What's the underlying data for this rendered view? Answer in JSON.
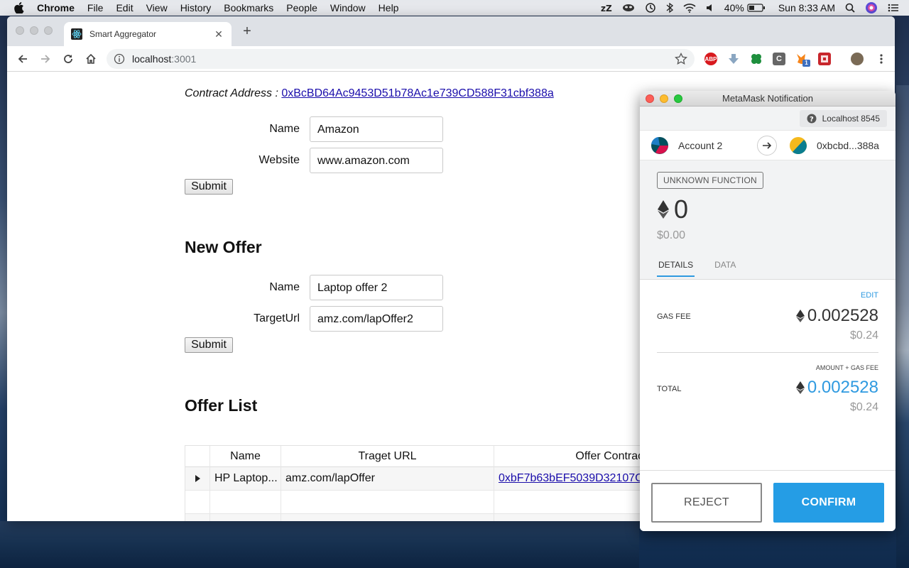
{
  "menubar": {
    "app": "Chrome",
    "items": [
      "File",
      "Edit",
      "View",
      "History",
      "Bookmarks",
      "People",
      "Window",
      "Help"
    ],
    "battery": "40%",
    "clock": "Sun 8:33 AM"
  },
  "browser": {
    "tab_title": "Smart Aggregator",
    "url_host": "localhost",
    "url_port": ":3001",
    "ext_abp": "ABP",
    "ext_c": "C",
    "ext_badge": "1"
  },
  "page": {
    "contract_label": "Contract Address :",
    "contract_address": "0xBcBD64Ac9453D51b78Ac1e739CD588F31cbf388a",
    "form1": {
      "name_label": "Name",
      "name_value": "Amazon",
      "website_label": "Website",
      "website_value": "www.amazon.com",
      "submit": "Submit"
    },
    "new_offer": {
      "heading": "New Offer",
      "name_label": "Name",
      "name_value": "Laptop offer 2",
      "target_label": "TargetUrl",
      "target_value": "amz.com/lapOffer2",
      "submit": "Submit"
    },
    "offer_list": {
      "heading": "Offer List",
      "columns": [
        "Name",
        "Traget URL",
        "Offer Contract"
      ],
      "rows": [
        {
          "name": "HP Laptop...",
          "target": "amz.com/lapOffer",
          "contract": "0xbF7b63bEF5039D32107C"
        }
      ]
    }
  },
  "metamask": {
    "window_title": "MetaMask Notification",
    "network": "Localhost 8545",
    "from_account": "Account 2",
    "to_address": "0xbcbd...388a",
    "function_badge": "UNKNOWN FUNCTION",
    "amount": "0",
    "amount_fiat": "$0.00",
    "tabs": [
      "DETAILS",
      "DATA"
    ],
    "edit": "EDIT",
    "gas_fee_label": "GAS FEE",
    "gas_fee_eth": "0.002528",
    "gas_fee_fiat": "$0.24",
    "amount_plus_gas_label": "AMOUNT + GAS FEE",
    "total_label": "TOTAL",
    "total_eth": "0.002528",
    "total_fiat": "$0.24",
    "reject": "REJECT",
    "confirm": "CONFIRM",
    "colors": {
      "accent": "#259de5",
      "total_text": "#2f9ae0"
    }
  }
}
